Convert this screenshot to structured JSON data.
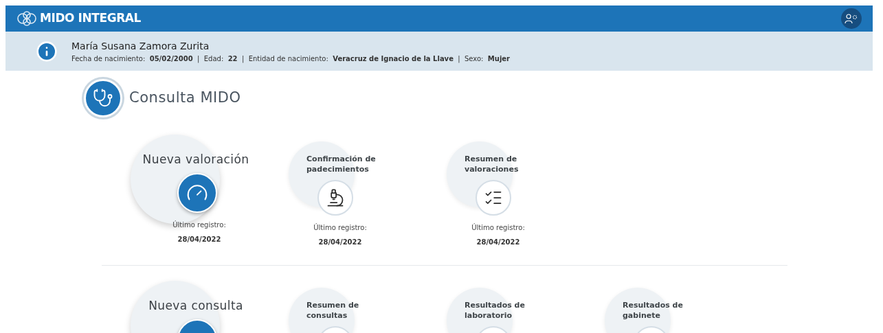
{
  "header": {
    "title": "MIDO INTEGRAL"
  },
  "patient": {
    "name": "María Susana Zamora Zurita",
    "details": "Fecha de nacimiento:  **05/02/2000**  |  Edad:  **22**  |  Entidad de nacimiento:  **Veracruz de Ignacio de la Llave**  |  Sexo:  **Mujer**"
  },
  "section": {
    "title": "Consulta MIDO"
  },
  "rows": [
    [
      {
        "kind": "primary",
        "title": "Nueva valoración",
        "record_label": "Último registro:",
        "record_date": "28/04/2022"
      },
      {
        "kind": "secondary",
        "title": "Confirmación de padecimientos",
        "record_label": "Último registro:",
        "record_date": "28/04/2022"
      },
      {
        "kind": "secondary",
        "title": "Resumen de valoraciones",
        "record_label": "Último registro:",
        "record_date": "28/04/2022"
      }
    ],
    [
      {
        "kind": "primary",
        "title": "Nueva consulta"
      },
      {
        "kind": "secondary",
        "title": "Resumen de consultas"
      },
      {
        "kind": "secondary",
        "title": "Resultados de laboratorio"
      },
      {
        "kind": "secondary",
        "title": "Resultados de gabinete"
      }
    ]
  ]
}
